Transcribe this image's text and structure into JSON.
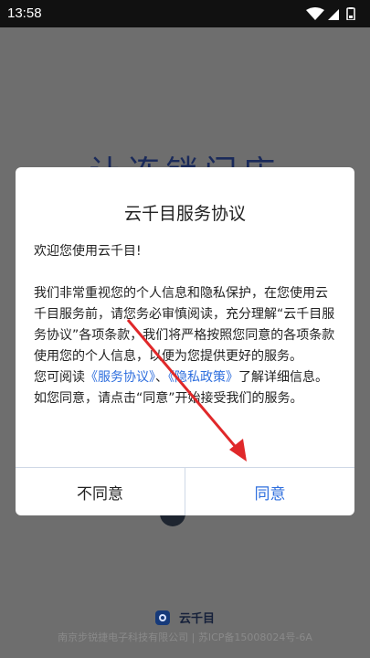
{
  "status_bar": {
    "time": "13:58"
  },
  "background": {
    "splash_title": "让连锁门店",
    "brand_name": "云千目",
    "icp": "南京步锐捷电子科技有限公司 | 苏ICP备15008024号-6A"
  },
  "dialog": {
    "title": "云千目服务协议",
    "greeting": "欢迎您使用云千目!",
    "paragraph1": "我们非常重视您的个人信息和隐私保护，在您使用云千目服务前，请您务必审慎阅读，充分理解“云千目服务协议”各项条款，我们将严格按照您同意的各项条款使用您的个人信息，以便为您提供更好的服务。",
    "p2_prefix": "您可阅读",
    "service_link": "《服务协议》",
    "p2_sep": "、",
    "privacy_link": "《隐私政策》",
    "p2_suffix": "了解详细信息。如您同意，请点击“同意”开始接受我们的服务。",
    "disagree_label": "不同意",
    "agree_label": "同意"
  },
  "colors": {
    "accent": "#2f6fde",
    "annotation_arrow": "#e0282a"
  }
}
